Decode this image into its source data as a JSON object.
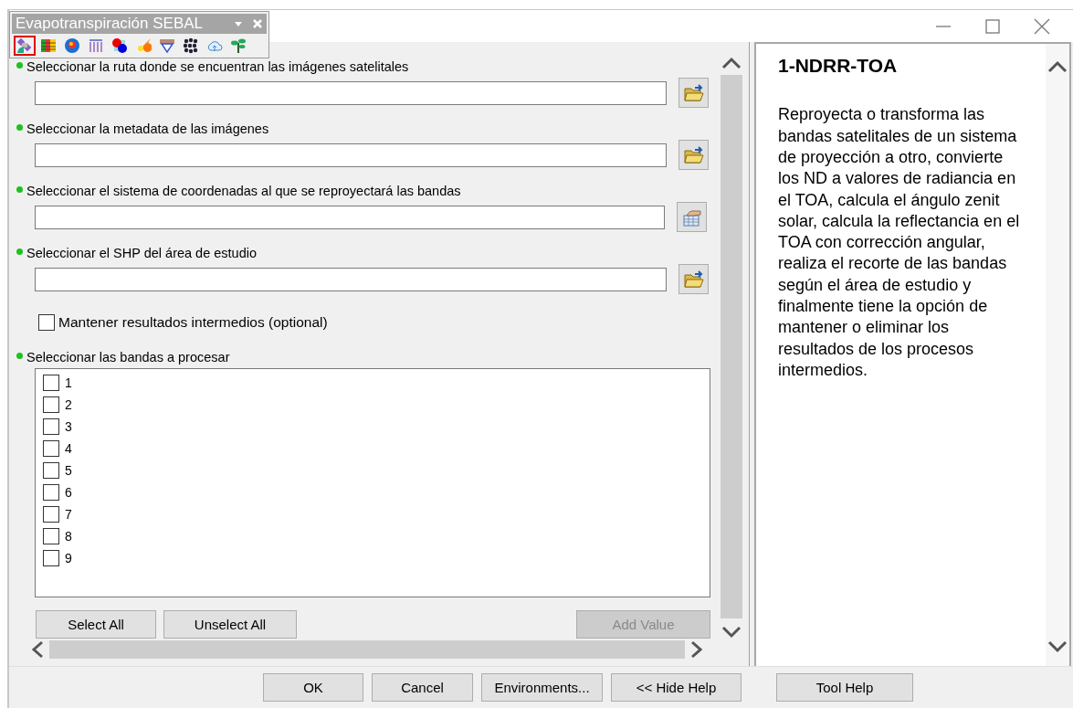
{
  "toolbar": {
    "title": "Evapotranspiración SEBAL",
    "tools": [
      {
        "kind": "satellite",
        "selected": true
      },
      {
        "kind": "grid",
        "selected": false
      },
      {
        "kind": "globe",
        "selected": false
      },
      {
        "kind": "tubes",
        "selected": false
      },
      {
        "kind": "dots",
        "selected": false
      },
      {
        "kind": "flame",
        "selected": false
      },
      {
        "kind": "shield",
        "selected": false
      },
      {
        "kind": "cluster",
        "selected": false
      },
      {
        "kind": "cloud",
        "selected": false
      },
      {
        "kind": "plant",
        "selected": false
      }
    ]
  },
  "params": [
    {
      "kind": "path",
      "label": "Seleccionar la ruta donde se encuentran las imágenes satelitales",
      "required": true
    },
    {
      "kind": "path",
      "label": "Seleccionar la metadata de las imágenes",
      "required": true
    },
    {
      "kind": "coords",
      "label": "Seleccionar el sistema de coordenadas al que se reproyectará las bandas",
      "required": true
    },
    {
      "kind": "path",
      "label": "Seleccionar el SHP del área de estudio",
      "required": true
    },
    {
      "kind": "checkbox",
      "label": "Mantener resultados intermedios (optional)",
      "checked": false
    },
    {
      "kind": "multivalue",
      "label": "Seleccionar las bandas a procesar",
      "required": true,
      "items": [
        {
          "label": "1",
          "checked": false
        },
        {
          "label": "2",
          "checked": false
        },
        {
          "label": "3",
          "checked": false
        },
        {
          "label": "4",
          "checked": false
        },
        {
          "label": "5",
          "checked": false
        },
        {
          "label": "6",
          "checked": false
        },
        {
          "label": "7",
          "checked": false
        },
        {
          "label": "8",
          "checked": false
        },
        {
          "label": "9",
          "checked": false
        }
      ],
      "buttons": [
        {
          "label": "Select All",
          "disabled": false
        },
        {
          "label": "Unselect All",
          "disabled": false
        },
        {
          "label": "Add Value",
          "disabled": true
        }
      ]
    }
  ],
  "help": {
    "title": "1-NDRR-TOA",
    "text": "Reproyecta o transforma las bandas satelitales de un sistema de proyección a otro, convierte los ND a valores de radiancia en el TOA, calcula el ángulo zenit solar, calcula la reflectancia en el TOA con corrección angular, realiza el recorte de las bandas según el área de estudio y finalmente tiene la opción de mantener o eliminar los resultados de los procesos intermedios."
  },
  "buttons": [
    "OK",
    "Cancel",
    "Environments...",
    "<< Hide Help",
    "Tool Help"
  ]
}
